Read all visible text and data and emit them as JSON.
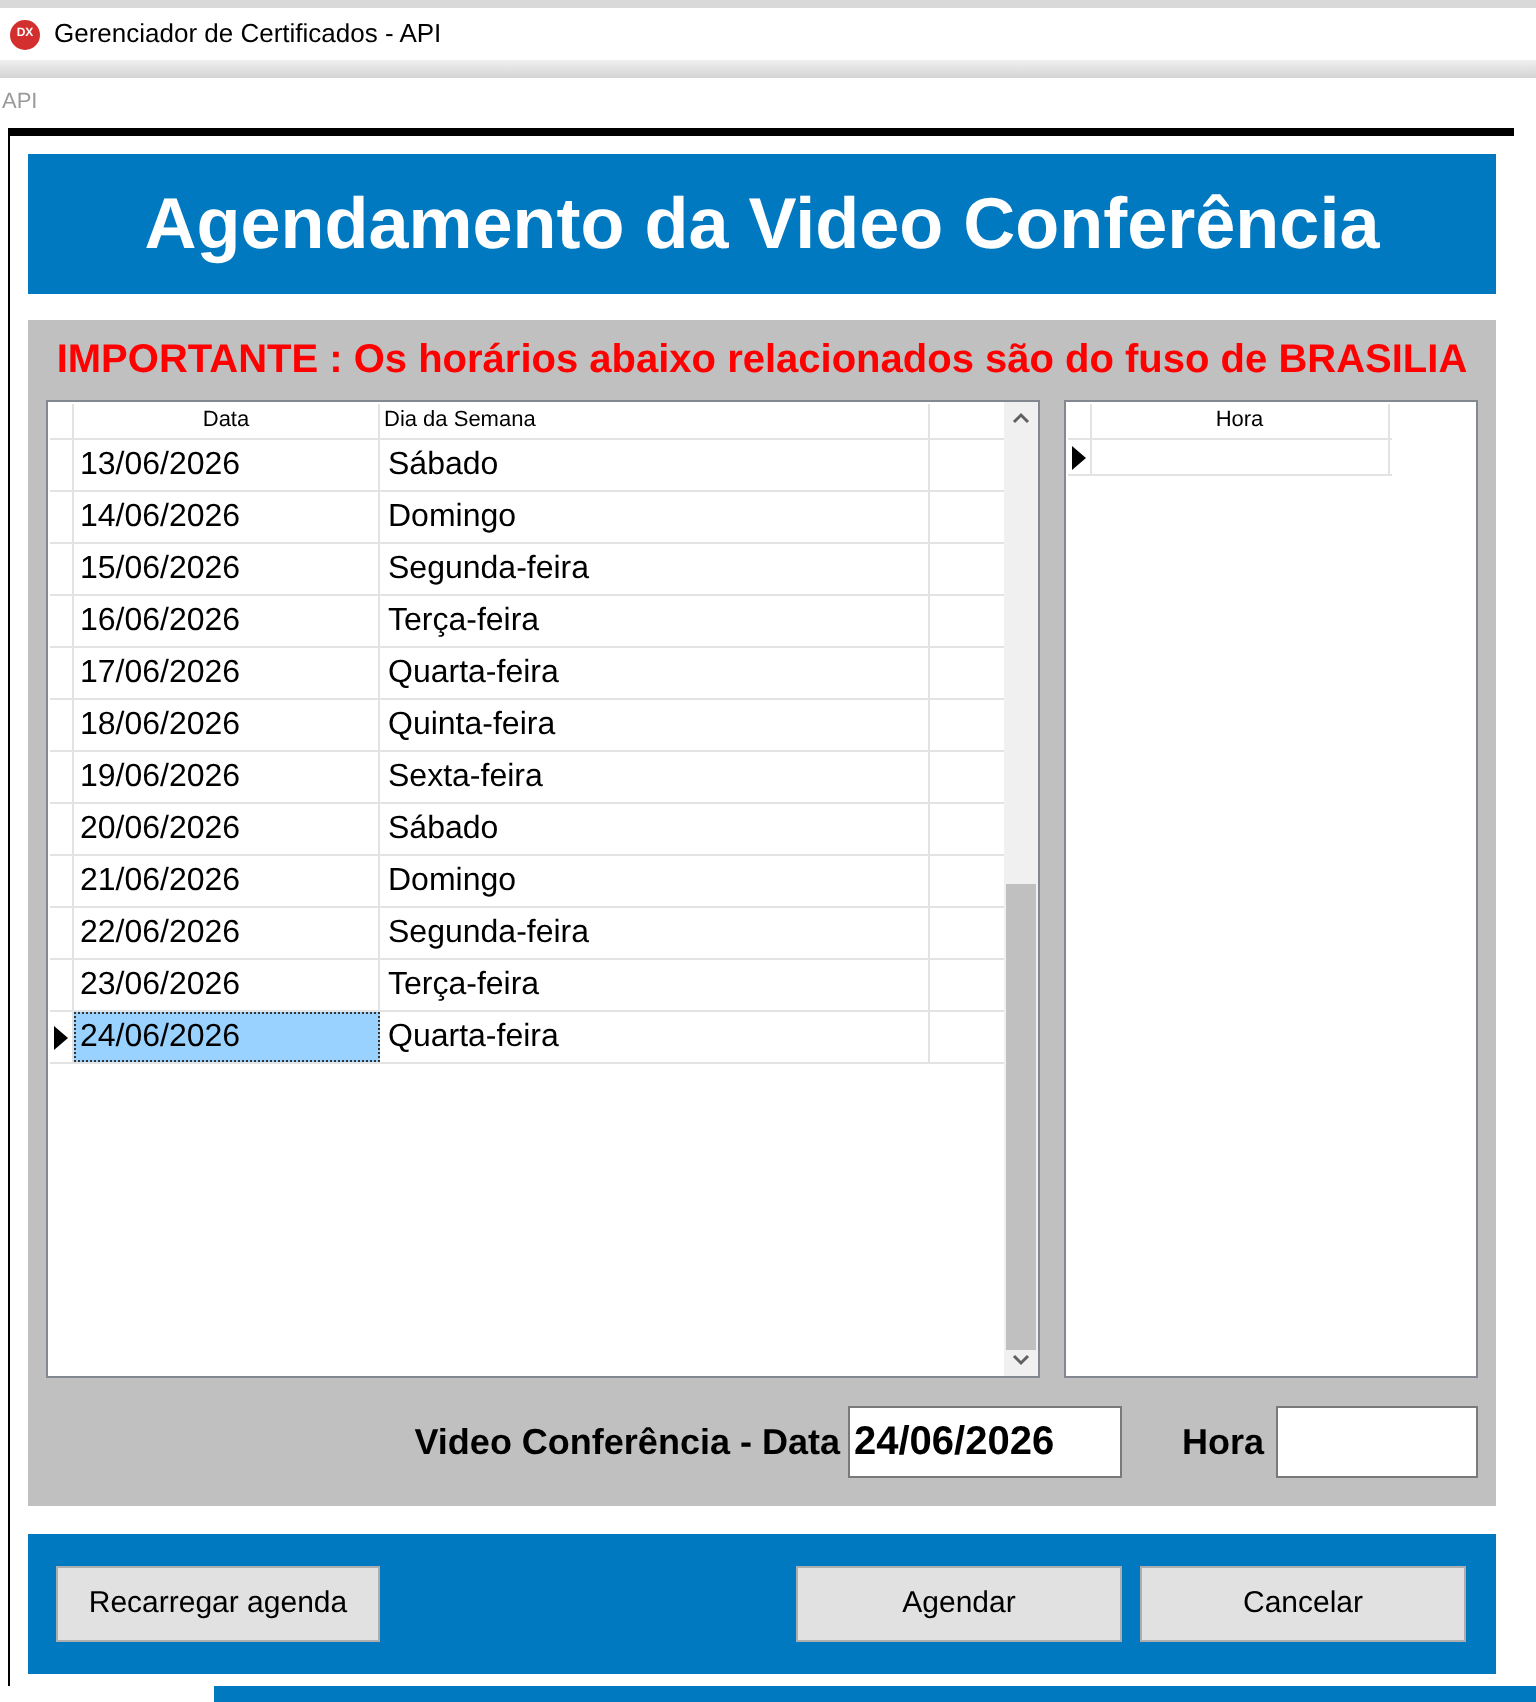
{
  "app_window": {
    "logo": "DX",
    "title": "Gerenciador de Certificados - API",
    "subtitle": "API"
  },
  "dialog": {
    "title": "Agendamento da Video Conferência",
    "notice": "IMPORTANTE : Os horários abaixo relacionados são do fuso de BRASILIA",
    "dates_grid": {
      "columns": [
        "Data",
        "Dia da Semana"
      ],
      "rows": [
        {
          "date": "13/06/2026",
          "weekday": "Sábado",
          "selected": false
        },
        {
          "date": "14/06/2026",
          "weekday": "Domingo",
          "selected": false
        },
        {
          "date": "15/06/2026",
          "weekday": "Segunda-feira",
          "selected": false
        },
        {
          "date": "16/06/2026",
          "weekday": "Terça-feira",
          "selected": false
        },
        {
          "date": "17/06/2026",
          "weekday": "Quarta-feira",
          "selected": false
        },
        {
          "date": "18/06/2026",
          "weekday": "Quinta-feira",
          "selected": false
        },
        {
          "date": "19/06/2026",
          "weekday": "Sexta-feira",
          "selected": false
        },
        {
          "date": "20/06/2026",
          "weekday": "Sábado",
          "selected": false
        },
        {
          "date": "21/06/2026",
          "weekday": "Domingo",
          "selected": false
        },
        {
          "date": "22/06/2026",
          "weekday": "Segunda-feira",
          "selected": false
        },
        {
          "date": "23/06/2026",
          "weekday": "Terça-feira",
          "selected": false
        },
        {
          "date": "24/06/2026",
          "weekday": "Quarta-feira",
          "selected": true
        }
      ]
    },
    "hours_grid": {
      "columns": [
        "Hora"
      ],
      "rows": [
        {
          "selected": true
        }
      ]
    },
    "date_field": {
      "label": "Video Conferência - Data",
      "value": "24/06/2026"
    },
    "hour_field": {
      "label": "Hora"
    },
    "buttons_left": [
      "Recarregar agenda"
    ],
    "buttons_right": [
      "Agendar",
      "Cancelar"
    ]
  }
}
